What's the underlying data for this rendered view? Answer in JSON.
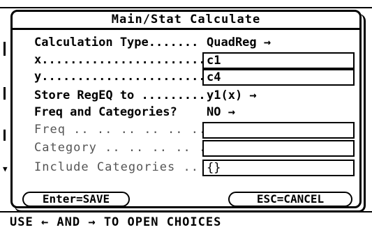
{
  "dialog": {
    "title": "Main/Stat Calculate",
    "rows": [
      {
        "label": "Calculation Type.......",
        "value": "QuadReg →"
      },
      {
        "label": "x..................................",
        "field": "c1"
      },
      {
        "label": "y..................................",
        "field": "c4"
      },
      {
        "label": "Store RegEQ to .........",
        "value": "y1(x) →"
      },
      {
        "label": "Freq and Categories?",
        "value": "NO →"
      },
      {
        "label": "Freq .. .. .. .. .. .. ..",
        "field": ""
      },
      {
        "label": "Category .. .. .. .. ..",
        "field": ""
      },
      {
        "label": "Include Categories ..",
        "field": "{}"
      }
    ],
    "enter_button": "Enter=SAVE",
    "esc_button": "ESC=CANCEL"
  },
  "statusbar": {
    "text": "USE ← AND → TO OPEN CHOICES"
  },
  "scroll_indicator": "▼"
}
